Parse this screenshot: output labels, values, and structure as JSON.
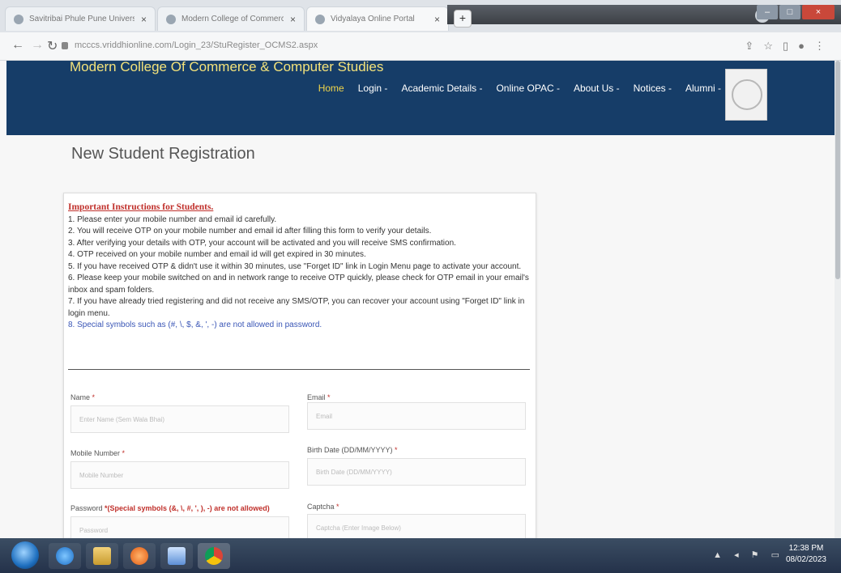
{
  "browser": {
    "tabs": [
      {
        "title": "Savitribai Phule Pune University"
      },
      {
        "title": "Modern College of Commerce"
      },
      {
        "title": "Vidyalaya Online Portal"
      }
    ],
    "url": "mcccs.vriddhionline.com/Login_23/StuRegister_OCMS2.aspx"
  },
  "site": {
    "brand": "Modern College Of Commerce & Computer Studies",
    "menu": [
      {
        "label": "Home"
      },
      {
        "label": "Login -"
      },
      {
        "label": "Academic Details -"
      },
      {
        "label": "Online OPAC -"
      },
      {
        "label": "About Us -"
      },
      {
        "label": "Notices -"
      },
      {
        "label": "Alumni -"
      }
    ]
  },
  "page": {
    "title": "New Student Registration",
    "instructions_heading": "Important Instructions for Students.",
    "instructions": [
      "1. Please enter your mobile number and email id carefully.",
      "2. You will receive OTP on your mobile number and email id after filling this form to verify your details.",
      "3. After verifying your details with OTP, your account will be activated and you will receive SMS confirmation.",
      "4. OTP received on your mobile number and email id will get expired in 30 minutes.",
      "5. If you have received OTP & didn't use it within 30 minutes, use \"Forget ID\" link in Login Menu page to activate your account.",
      "6. Please keep your mobile switched on and in network range to receive OTP quickly, please check for OTP email in your email's inbox and spam folders.",
      "7. If you have already tried registering and did not receive any SMS/OTP, you can recover your account using \"Forget ID\" link in login menu.",
      "8. Special symbols such as (#, \\, $, &, ', -) are not allowed in password."
    ]
  },
  "form": {
    "name_label": "Name",
    "name_placeholder": "Enter Name (Sem Wala Bhai)",
    "email_label": "Email",
    "email_placeholder": "Email",
    "mobile_label": "Mobile Number",
    "mobile_placeholder": "Mobile Number",
    "birth_label": "Birth Date (DD/MM/YYYY)",
    "birth_placeholder": "Birth Date (DD/MM/YYYY)",
    "password_label": "Password",
    "password_note": "*(Special symbols (&, \\, #, ', ), -) are not allowed)",
    "password_placeholder": "Password",
    "captcha_label": "Captcha",
    "captcha_placeholder": "Captcha (Enter Image Below)",
    "required_mark": "*"
  },
  "taskbar": {
    "time": "12:38 PM",
    "date": "08/02/2023"
  }
}
